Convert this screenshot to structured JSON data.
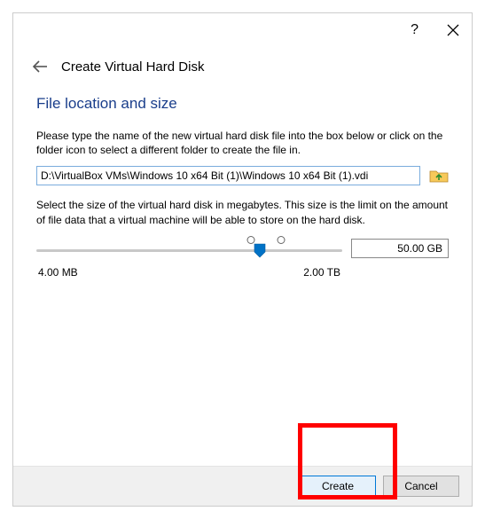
{
  "dialog": {
    "title": "Create Virtual Hard Disk",
    "section_title": "File location and size",
    "desc1": "Please type the name of the new virtual hard disk file into the box below or click on the folder icon to select a different folder to create the file in.",
    "path_value": "D:\\VirtualBox VMs\\Windows 10 x64 Bit (1)\\Windows 10 x64 Bit (1).vdi",
    "desc2": "Select the size of the virtual hard disk in megabytes. This size is the limit on the amount of file data that a virtual machine will be able to store on the hard disk.",
    "size_value": "50.00 GB",
    "slider_min_label": "4.00 MB",
    "slider_max_label": "2.00 TB"
  },
  "buttons": {
    "create": "Create",
    "cancel": "Cancel"
  }
}
